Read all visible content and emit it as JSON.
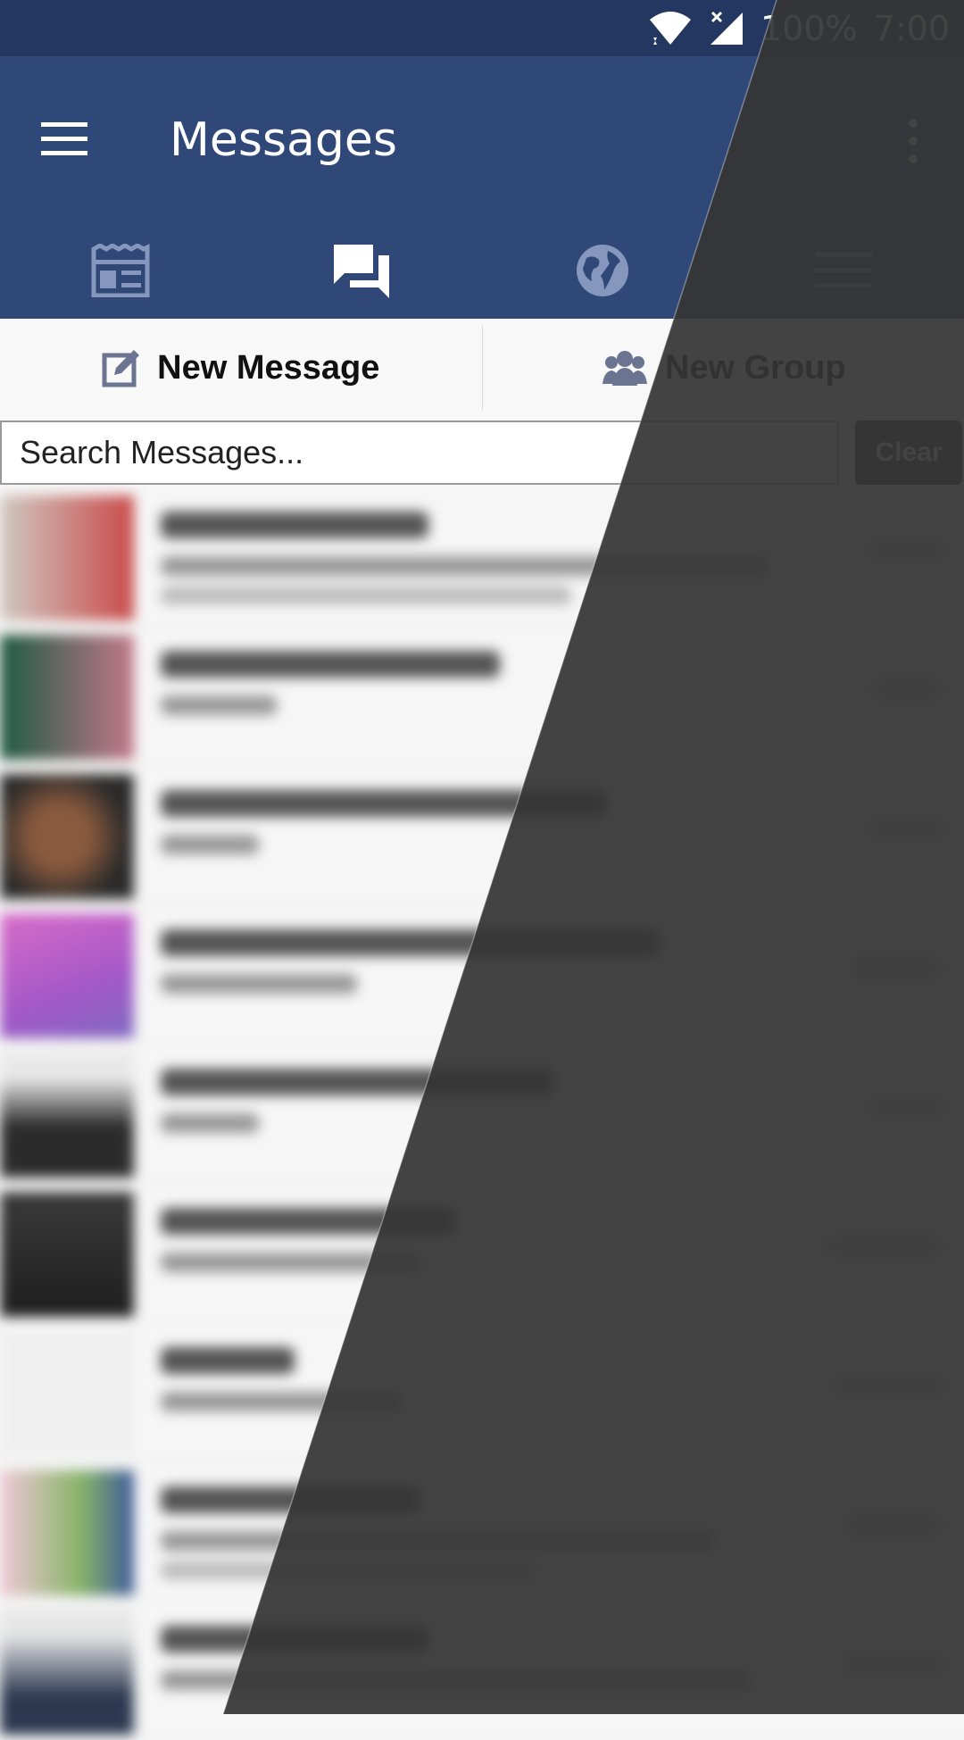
{
  "status_bar": {
    "battery": "100%",
    "time": "7:00",
    "icons": [
      "wifi-icon",
      "no-signal-icon"
    ]
  },
  "app_bar": {
    "title": "Messages",
    "menu_icon": "hamburger-menu-icon",
    "overflow_icon": "more-vertical-icon"
  },
  "tabs": [
    {
      "name": "news-feed",
      "icon": "newspaper-icon",
      "active": false
    },
    {
      "name": "messages",
      "icon": "chat-bubbles-icon",
      "active": true
    },
    {
      "name": "notifications",
      "icon": "globe-icon",
      "active": false
    },
    {
      "name": "more",
      "icon": "menu-lines-icon",
      "active": false
    }
  ],
  "actions": {
    "new_message": "New Message",
    "new_group": "New Group"
  },
  "search": {
    "placeholder": "Search Messages...",
    "clear_label": "Clear"
  },
  "colors": {
    "status_bar": "#243760",
    "app_bar": "#2f4878",
    "tab_inactive": "#8597bd",
    "tab_active": "#ffffff",
    "dark_theme": "#353535",
    "light_theme": "#f6f6f6"
  }
}
